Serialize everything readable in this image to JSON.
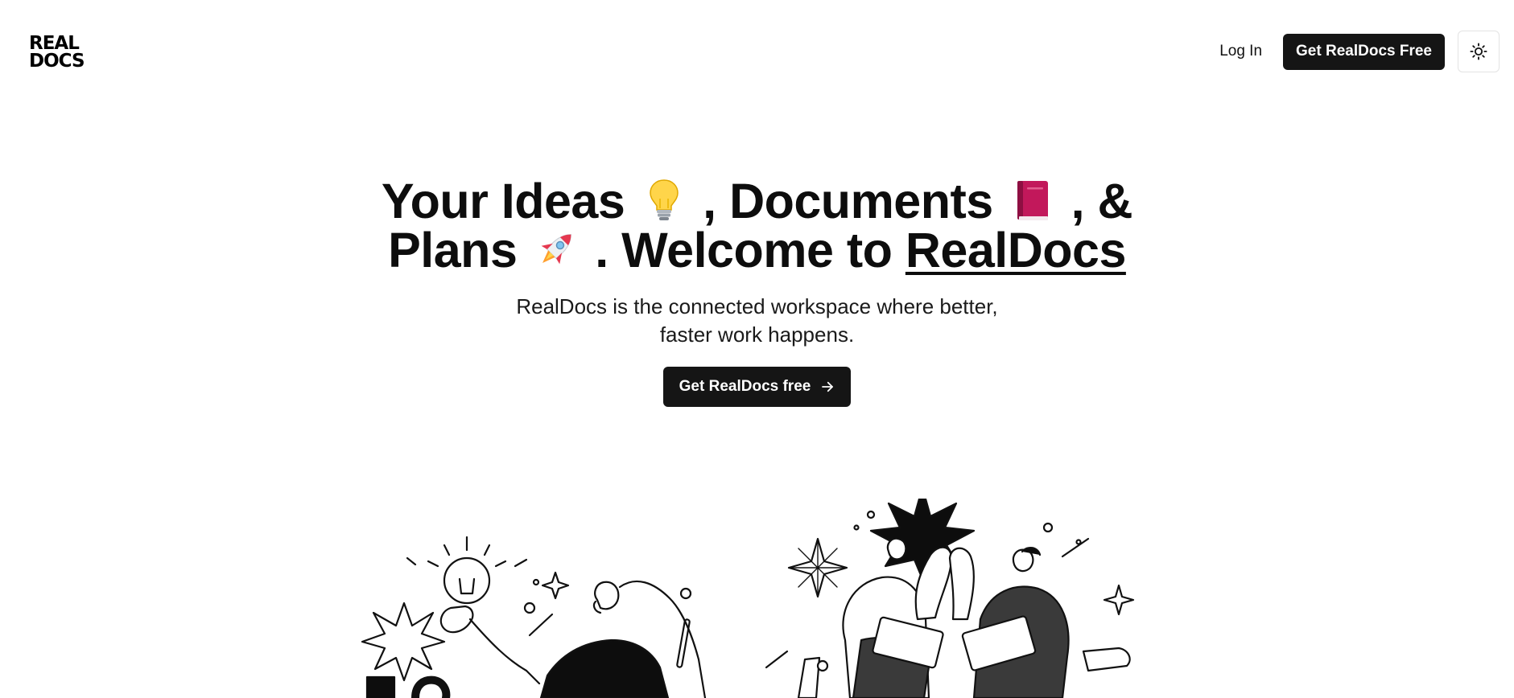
{
  "header": {
    "logo": {
      "line1": "REAL",
      "line2": "DOCS"
    },
    "login_label": "Log In",
    "cta_label": "Get RealDocs Free",
    "theme_toggle_icon": "sun-icon"
  },
  "hero": {
    "title_part1": "Your Ideas",
    "title_part2": ", Documents",
    "title_part3": ", &",
    "title_part4": "Plans",
    "title_part5": ". Welcome to",
    "title_brand": "RealDocs",
    "emojis": [
      "lightbulb-emoji",
      "book-emoji",
      "rocket-emoji"
    ],
    "subtitle": "RealDocs is the connected workspace where better, faster work happens.",
    "cta_label": "Get RealDocs free",
    "cta_icon": "arrow-right-icon"
  },
  "colors": {
    "background": "#ffffff",
    "text": "#111111",
    "button_bg": "#151515",
    "button_text": "#ffffff",
    "book_red": "#c2185b",
    "rocket_red": "#e53950",
    "bulb_yellow": "#ffd54a"
  }
}
